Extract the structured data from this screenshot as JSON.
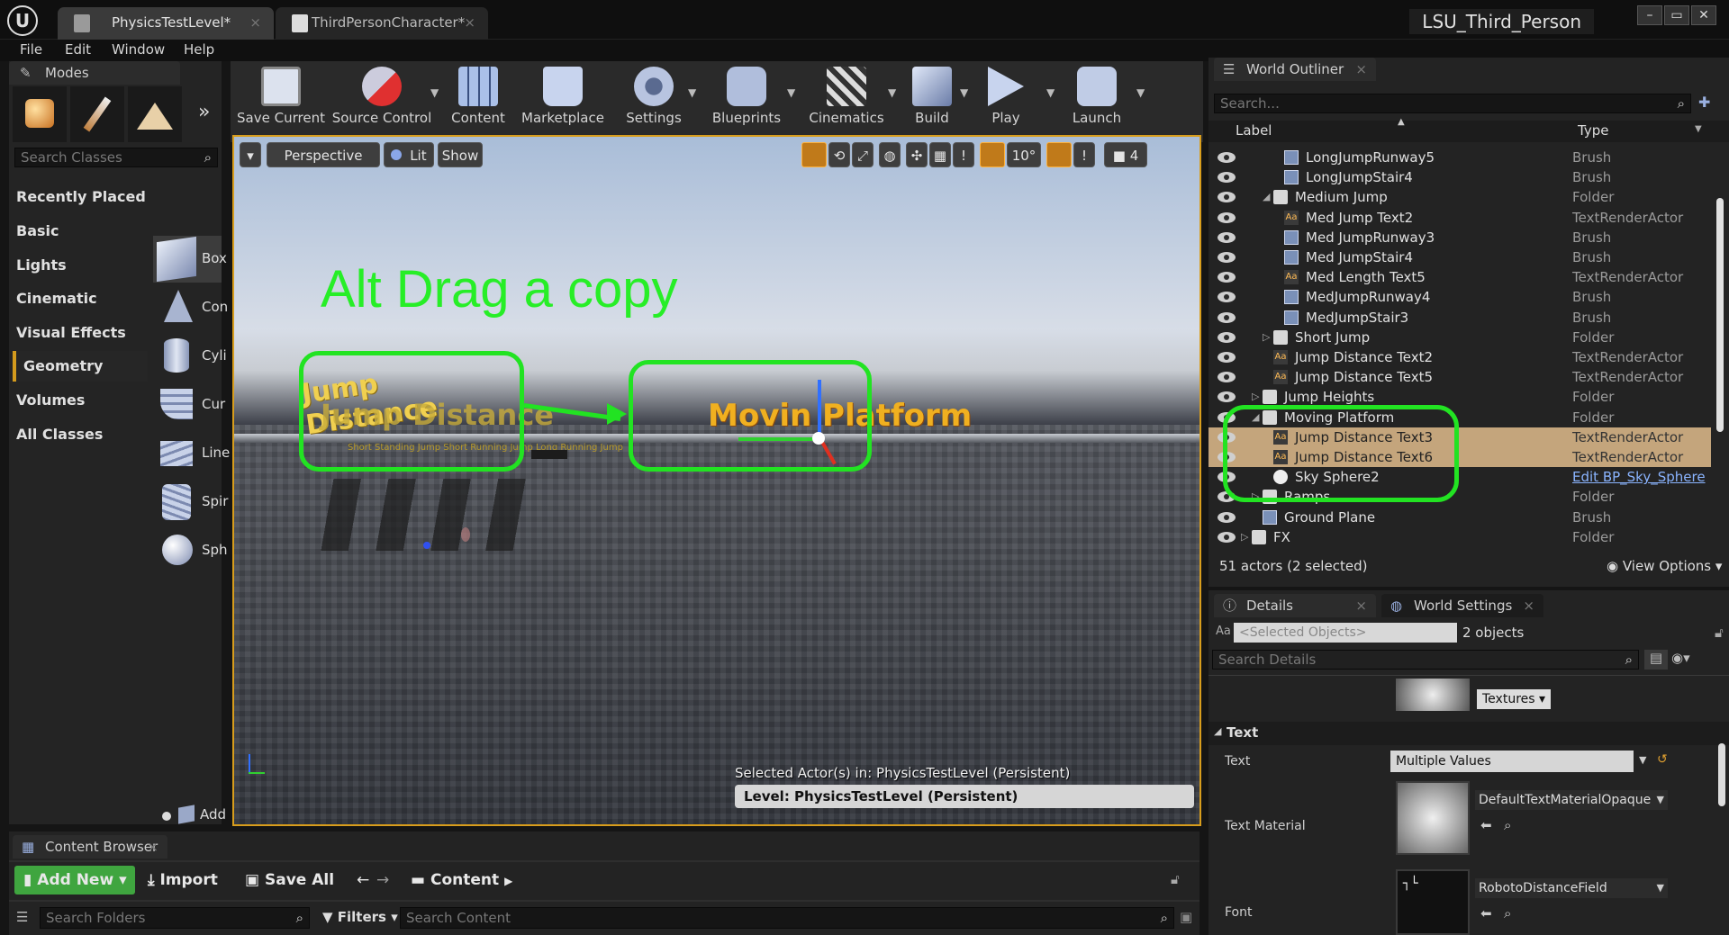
{
  "window": {
    "tabs": [
      {
        "label": "PhysicsTestLevel*"
      },
      {
        "label": "ThirdPersonCharacter*"
      }
    ],
    "project_name": "LSU_Third_Person"
  },
  "menu": [
    "File",
    "Edit",
    "Window",
    "Help"
  ],
  "modes": {
    "title": "Modes",
    "search_placeholder": "Search Classes",
    "categories": [
      "Recently Placed",
      "Basic",
      "Lights",
      "Cinematic",
      "Visual Effects",
      "Geometry",
      "Volumes",
      "All Classes"
    ],
    "selected_category": "Geometry",
    "shapes": [
      "Box",
      "Con",
      "Cyli",
      "Cur",
      "Line",
      "Spir",
      "Sph"
    ],
    "add_label": "Add"
  },
  "toolbar": [
    "Save Current",
    "Source Control",
    "Content",
    "Marketplace",
    "Settings",
    "Blueprints",
    "Cinematics",
    "Build",
    "Play",
    "Launch"
  ],
  "viewport": {
    "perspective_label": "Perspective",
    "lit_label": "Lit",
    "show_label": "Show",
    "angle_snap": "10°",
    "camera_speed": "4",
    "overlay_text": "Alt Drag a copy",
    "text_actor_1": "Jump Distance",
    "text_actor_1b": "Jump Distance",
    "text_actor_sub": "Short Standing Jump    Short Running Jump    Long Running Jump",
    "text_actor_2": "Movin  Platform",
    "selected_actor_info": "Selected Actor(s) in:  PhysicsTestLevel (Persistent)",
    "level_label": "Level:  PhysicsTestLevel (Persistent)"
  },
  "outliner": {
    "title": "World Outliner",
    "search_placeholder": "Search...",
    "col_label": "Label",
    "col_type": "Type",
    "rows": [
      {
        "label": "LongJumpRunway5",
        "type": "Brush",
        "icon": "brush",
        "indent": 84
      },
      {
        "label": "LongJumpStair4",
        "type": "Brush",
        "icon": "brush",
        "indent": 84
      },
      {
        "label": "Medium Jump",
        "type": "Folder",
        "icon": "folder",
        "indent": 72,
        "expand": "open"
      },
      {
        "label": "Med Jump Text2",
        "type": "TextRenderActor",
        "icon": "textactor",
        "indent": 84
      },
      {
        "label": "Med JumpRunway3",
        "type": "Brush",
        "icon": "brush",
        "indent": 84
      },
      {
        "label": "Med JumpStair4",
        "type": "Brush",
        "icon": "brush",
        "indent": 84
      },
      {
        "label": "Med Length Text5",
        "type": "TextRenderActor",
        "icon": "textactor",
        "indent": 84
      },
      {
        "label": "MedJumpRunway4",
        "type": "Brush",
        "icon": "brush",
        "indent": 84
      },
      {
        "label": "MedJumpStair3",
        "type": "Brush",
        "icon": "brush",
        "indent": 84
      },
      {
        "label": "Short Jump",
        "type": "Folder",
        "icon": "folder",
        "indent": 72,
        "expand": "closed"
      },
      {
        "label": "Jump Distance Text2",
        "type": "TextRenderActor",
        "icon": "textactor",
        "indent": 72
      },
      {
        "label": "Jump Distance Text5",
        "type": "TextRenderActor",
        "icon": "textactor",
        "indent": 72
      },
      {
        "label": "Jump Heights",
        "type": "Folder",
        "icon": "folder",
        "indent": 60,
        "expand": "closed"
      },
      {
        "label": "Moving Platform",
        "type": "Folder",
        "icon": "folder",
        "indent": 60,
        "expand": "open"
      },
      {
        "label": "Jump Distance Text3",
        "type": "TextRenderActor",
        "icon": "textactor",
        "indent": 72,
        "selected": true
      },
      {
        "label": "Jump Distance Text6",
        "type": "TextRenderActor",
        "icon": "textactor",
        "indent": 72,
        "selected": true
      },
      {
        "label": "Sky Sphere2",
        "type": "Edit BP_Sky_Sphere",
        "icon": "sphere",
        "indent": 72,
        "link": true
      },
      {
        "label": "Ramps",
        "type": "Folder",
        "icon": "folder",
        "indent": 60,
        "expand": "closed"
      },
      {
        "label": "Ground Plane",
        "type": "Brush",
        "icon": "brush",
        "indent": 60
      },
      {
        "label": "FX",
        "type": "Folder",
        "icon": "folder",
        "indent": 48,
        "expand": "closed"
      }
    ],
    "actor_count": "51 actors (2 selected)",
    "view_options": "View Options"
  },
  "details": {
    "tab_details": "Details",
    "tab_world_settings": "World Settings",
    "selected_objects_placeholder": "<Selected Objects>",
    "object_count": "2 objects",
    "search_placeholder": "Search Details",
    "textures_label": "Textures",
    "section_text": "Text",
    "text_label": "Text",
    "text_value": "Multiple Values",
    "text_material_label": "Text Material",
    "text_material_value": "DefaultTextMaterialOpaque",
    "font_label": "Font",
    "font_value": "RobotoDistanceField"
  },
  "content_browser": {
    "title": "Content Browser",
    "add_new": "Add New",
    "import": "Import",
    "save_all": "Save All",
    "path": "Content",
    "search_folders_placeholder": "Search Folders",
    "filters": "Filters",
    "search_content_placeholder": "Search Content"
  },
  "colors": {
    "highlight_green": "#22e322",
    "selection_tan": "#c4a57c",
    "accent_orange": "#d49b1d",
    "add_new_green": "#3fa53f"
  }
}
